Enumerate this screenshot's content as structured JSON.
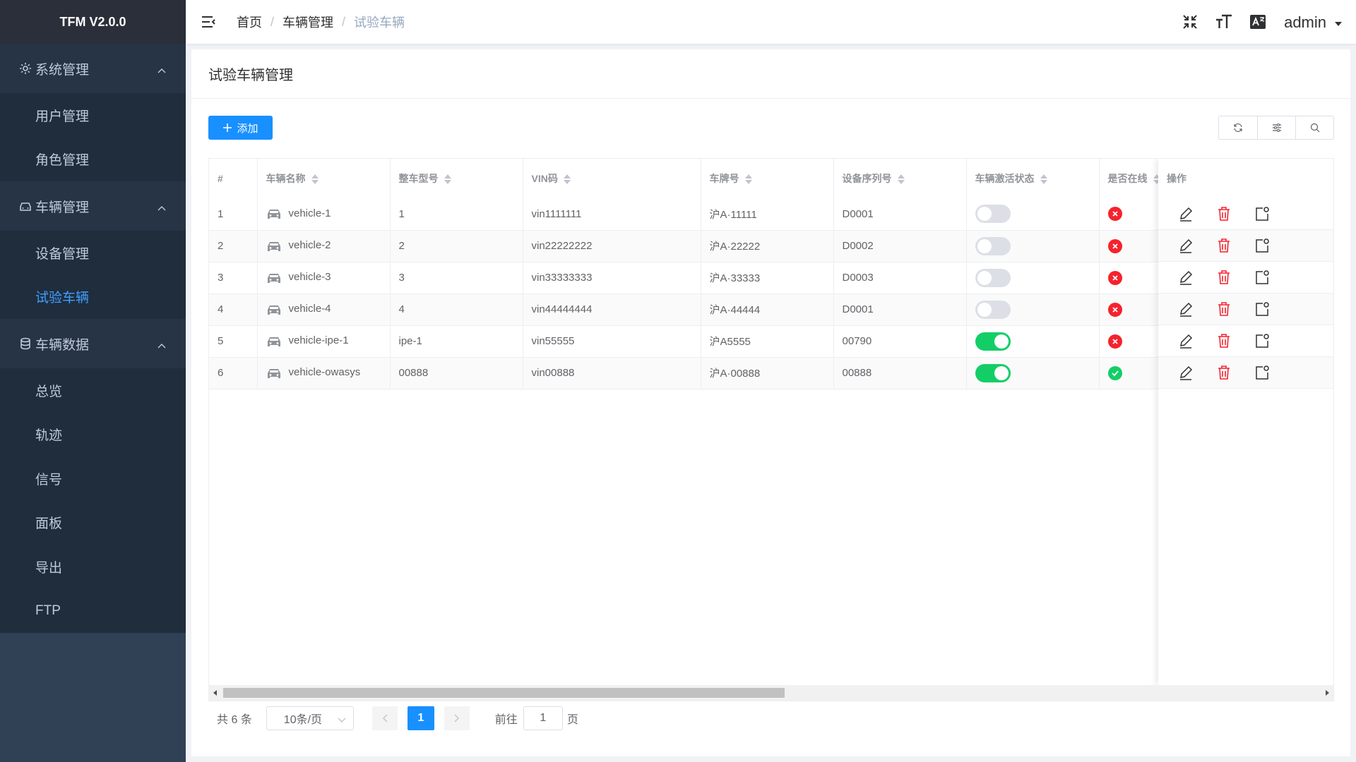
{
  "app": {
    "title": "TFM V2.0.0"
  },
  "sidebar": {
    "groups": [
      {
        "label": "系统管理",
        "icon": "gear-icon",
        "items": [
          {
            "label": "用户管理"
          },
          {
            "label": "角色管理"
          }
        ]
      },
      {
        "label": "车辆管理",
        "icon": "car-icon",
        "items": [
          {
            "label": "设备管理"
          },
          {
            "label": "试验车辆",
            "active": true
          }
        ]
      },
      {
        "label": "车辆数据",
        "icon": "database-icon",
        "items": [
          {
            "label": "总览"
          },
          {
            "label": "轨迹"
          },
          {
            "label": "信号"
          },
          {
            "label": "面板"
          },
          {
            "label": "导出"
          },
          {
            "label": "FTP"
          }
        ]
      }
    ]
  },
  "header": {
    "breadcrumb": [
      "首页",
      "车辆管理",
      "试验车辆"
    ],
    "separator": "/",
    "user": "admin",
    "icons": [
      "fullscreen-exit-icon",
      "font-size-icon",
      "translate-icon",
      "hamburger-icon"
    ]
  },
  "page": {
    "title": "试验车辆管理",
    "add_label": "添加",
    "tool_icons": [
      "refresh-icon",
      "filter-icon",
      "search-icon"
    ]
  },
  "table": {
    "columns": [
      "#",
      "车辆名称",
      "整车型号",
      "VIN码",
      "车牌号",
      "设备序列号",
      "车辆激活状态",
      "是否在线",
      "操作"
    ],
    "rows": [
      {
        "index": "1",
        "name": "vehicle-1",
        "model": "1",
        "vin": "vin1111111",
        "plate": "沪A·11111",
        "device": "D0001",
        "active": false,
        "online": false
      },
      {
        "index": "2",
        "name": "vehicle-2",
        "model": "2",
        "vin": "vin22222222",
        "plate": "沪A·22222",
        "device": "D0002",
        "active": false,
        "online": false
      },
      {
        "index": "3",
        "name": "vehicle-3",
        "model": "3",
        "vin": "vin33333333",
        "plate": "沪A·33333",
        "device": "D0003",
        "active": false,
        "online": false
      },
      {
        "index": "4",
        "name": "vehicle-4",
        "model": "4",
        "vin": "vin44444444",
        "plate": "沪A·44444",
        "device": "D0001",
        "active": false,
        "online": false
      },
      {
        "index": "5",
        "name": "vehicle-ipe-1",
        "model": "ipe-1",
        "vin": "vin55555",
        "plate": "沪A5555",
        "device": "00790",
        "active": true,
        "online": false
      },
      {
        "index": "6",
        "name": "vehicle-owasys",
        "model": "00888",
        "vin": "vin00888",
        "plate": "沪A·00888",
        "device": "00888",
        "active": true,
        "online": true
      }
    ],
    "row_action_icons": [
      "edit-icon",
      "delete-icon",
      "detail-icon"
    ]
  },
  "pagination": {
    "total_text": "共 6 条",
    "page_size": "10条/页",
    "current_page": "1",
    "goto_label": "前往",
    "goto_value": "1",
    "page_unit": "页"
  },
  "colors": {
    "primary": "#1890ff",
    "sidebar_bg": "#304156",
    "success": "#13ce66",
    "danger": "#f5222d"
  }
}
